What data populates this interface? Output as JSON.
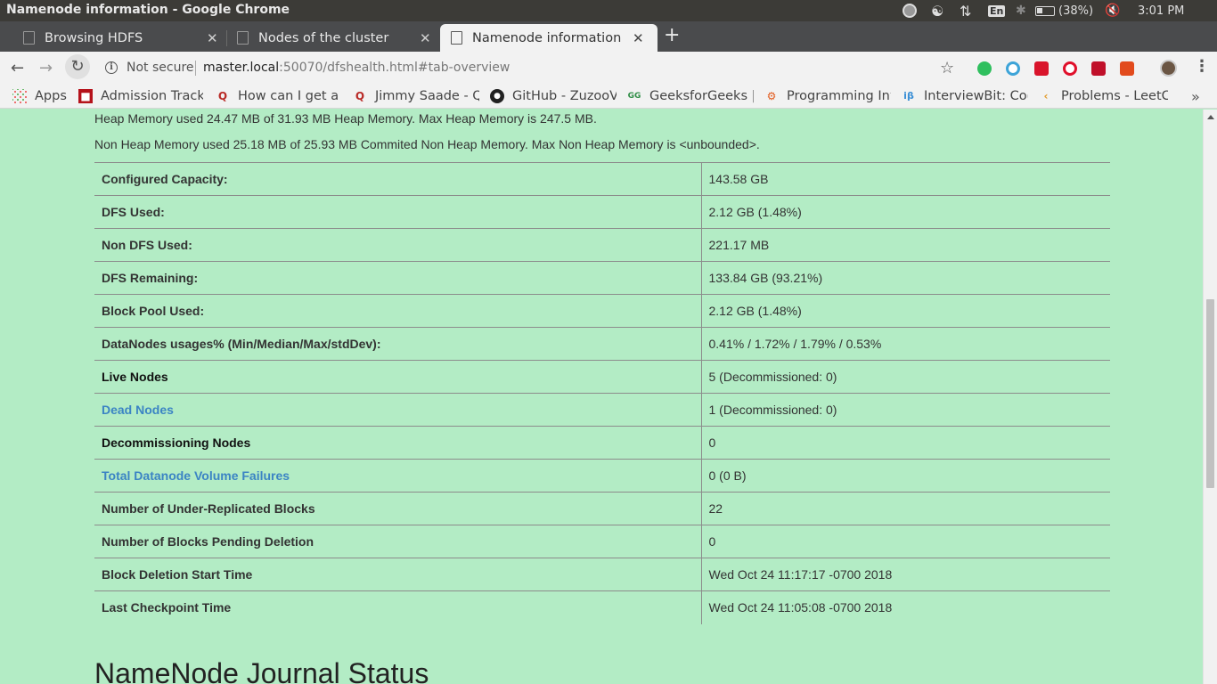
{
  "os": {
    "window_title": "Namenode information - Google Chrome",
    "battery": "(38%)",
    "clock": "3:01 PM",
    "keyboard": "En",
    "tray_icons": [
      "record-icon",
      "sync-icon",
      "network-icon",
      "keyboard-icon",
      "bluetooth-icon",
      "battery-icon",
      "volume-muted-icon"
    ]
  },
  "tabs": [
    {
      "label": "Browsing HDFS",
      "active": false
    },
    {
      "label": "Nodes of the cluster",
      "active": false
    },
    {
      "label": "Namenode information",
      "active": true
    }
  ],
  "toolbar": {
    "security_label": "Not secure",
    "url_host": "master.local",
    "url_rest": ":50070/dfshealth.html#tab-overview"
  },
  "bookmarks": [
    {
      "label": "Apps",
      "icon": "apps-grid-icon"
    },
    {
      "label": "Admission Track",
      "fade": "i",
      "icon": "admission-icon"
    },
    {
      "label": "How can I get a j",
      "fade": "o",
      "icon": "quora-icon"
    },
    {
      "label": "Jimmy Saade - Q",
      "fade": "u",
      "icon": "quora-icon"
    },
    {
      "label": "GitHub - ZuzooV",
      "fade": "i",
      "icon": "github-icon"
    },
    {
      "label": "GeeksforGeeks |",
      "fade": "",
      "icon": "geeksforgeeks-icon"
    },
    {
      "label": "Programming In",
      "fade": "t",
      "icon": "programming-icon"
    },
    {
      "label": "InterviewBit: Co",
      "fade": "d",
      "icon": "interviewbit-icon"
    },
    {
      "label": "Problems - LeetC",
      "fade": "o",
      "icon": "leetcode-icon"
    }
  ],
  "content": {
    "heap_line": "Heap Memory used 24.47 MB of 31.93 MB Heap Memory. Max Heap Memory is 247.5 MB.",
    "non_heap_line": "Non Heap Memory used 25.18 MB of 25.93 MB Commited Non Heap Memory. Max Non Heap Memory is <unbounded>.",
    "rows": [
      {
        "label": "Configured Capacity:",
        "value": "143.58 GB"
      },
      {
        "label": "DFS Used:",
        "value": "2.12 GB (1.48%)"
      },
      {
        "label": "Non DFS Used:",
        "value": "221.17 MB"
      },
      {
        "label": "DFS Remaining:",
        "value": "133.84 GB (93.21%)"
      },
      {
        "label": "Block Pool Used:",
        "value": "2.12 GB (1.48%)"
      },
      {
        "label": "DataNodes usages% (Min/Median/Max/stdDev):",
        "value": "0.41% / 1.72% / 1.79% / 0.53%"
      },
      {
        "label": "Live Nodes",
        "value": "5 (Decommissioned: 0)"
      },
      {
        "label": "Dead Nodes",
        "value": "1 (Decommissioned: 0)"
      },
      {
        "label": "Decommissioning Nodes",
        "value": "0"
      },
      {
        "label": "Total Datanode Volume Failures",
        "value": "0 (0 B)"
      },
      {
        "label": "Number of Under-Replicated Blocks",
        "value": "22"
      },
      {
        "label": "Number of Blocks Pending Deletion",
        "value": "0"
      },
      {
        "label": "Block Deletion Start Time",
        "value": "Wed Oct 24 11:17:17 -0700 2018"
      },
      {
        "label": "Last Checkpoint Time",
        "value": "Wed Oct 24 11:05:08 -0700 2018"
      }
    ],
    "journal_heading": "NameNode Journal Status"
  },
  "colors": {
    "page_bg": "#b3ecc5",
    "link": "#3b84c4",
    "tab_strip": "#4a4b4d",
    "os_bar": "#3c3b37"
  }
}
